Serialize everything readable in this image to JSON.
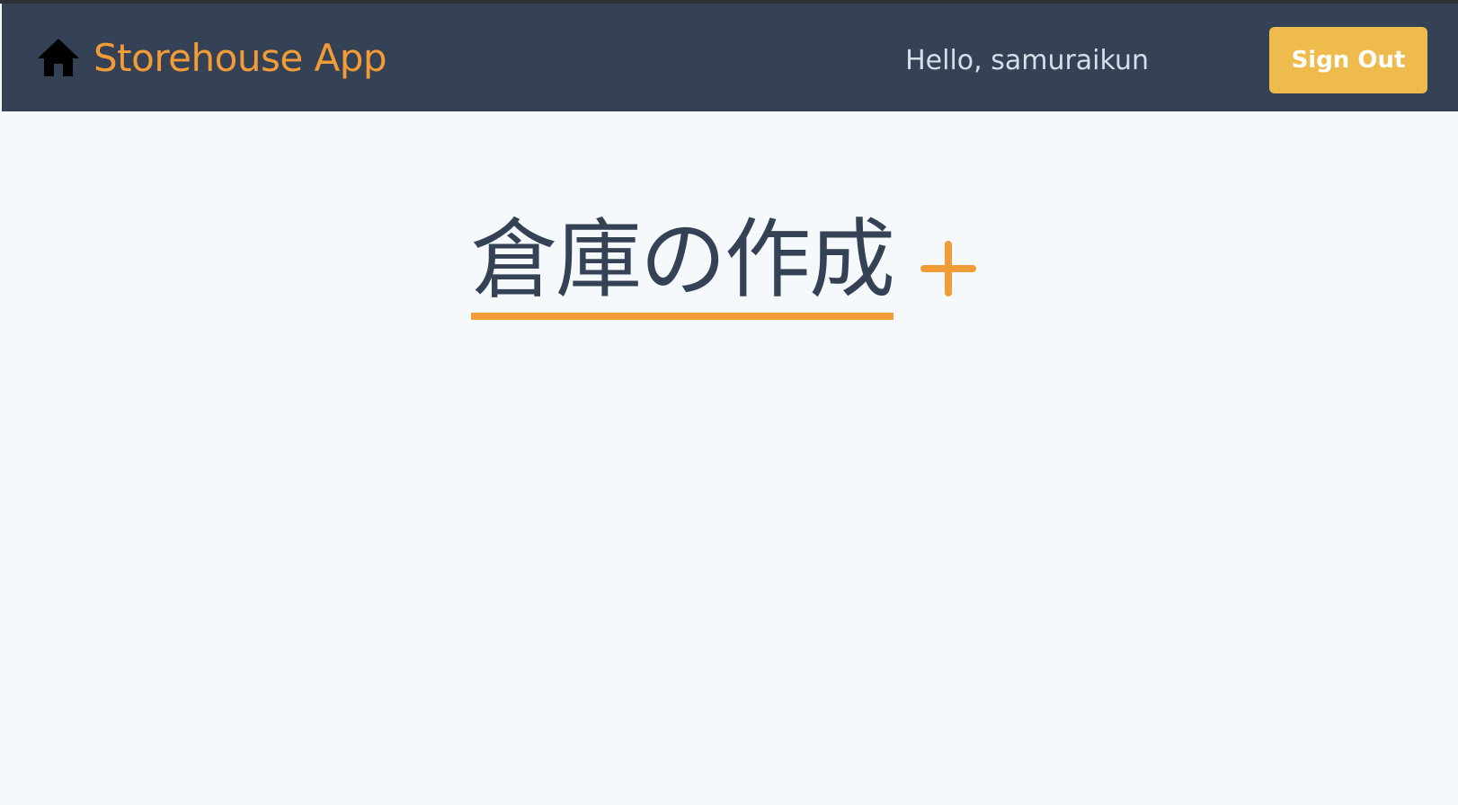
{
  "navbar": {
    "brand_label": "Storehouse App",
    "brand_icon": "home-icon",
    "greeting": "Hello, samuraikun",
    "signout_label": "Sign Out"
  },
  "main": {
    "create_title": "倉庫の作成",
    "create_icon": "plus-icon"
  },
  "colors": {
    "navbar_bg": "#354154",
    "accent": "#f29c38",
    "signout_bg": "#efbb4c",
    "page_bg": "#f5f9fc",
    "title_text": "#354154",
    "greeting_text": "#d7dee9"
  }
}
